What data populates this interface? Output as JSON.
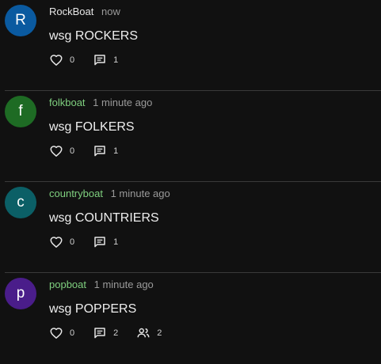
{
  "colors": {
    "background": "#111111",
    "divider": "#3a3a3a",
    "default_username": "#e6e6e6",
    "boat_username": "#7fd07f",
    "timestamp": "#9a9a9a"
  },
  "posts": [
    {
      "avatar_letter": "R",
      "avatar_color": "#0a5aa0",
      "username": "RockBoat",
      "username_color": "#e6e6e6",
      "timestamp": "now",
      "content": "wsg ROCKERS",
      "likes": "0",
      "comments": "1",
      "participants": null
    },
    {
      "avatar_letter": "f",
      "avatar_color": "#1e6b24",
      "username": "folkboat",
      "username_color": "#7fd07f",
      "timestamp": "1 minute ago",
      "content": "wsg FOLKERS",
      "likes": "0",
      "comments": "1",
      "participants": null
    },
    {
      "avatar_letter": "c",
      "avatar_color": "#0b5f66",
      "username": "countryboat",
      "username_color": "#7fd07f",
      "timestamp": "1 minute ago",
      "content": "wsg COUNTRIERS",
      "likes": "0",
      "comments": "1",
      "participants": null
    },
    {
      "avatar_letter": "p",
      "avatar_color": "#4a1d8a",
      "username": "popboat",
      "username_color": "#7fd07f",
      "timestamp": "1 minute ago",
      "content": "wsg POPPERS",
      "likes": "0",
      "comments": "2",
      "participants": "2"
    }
  ]
}
